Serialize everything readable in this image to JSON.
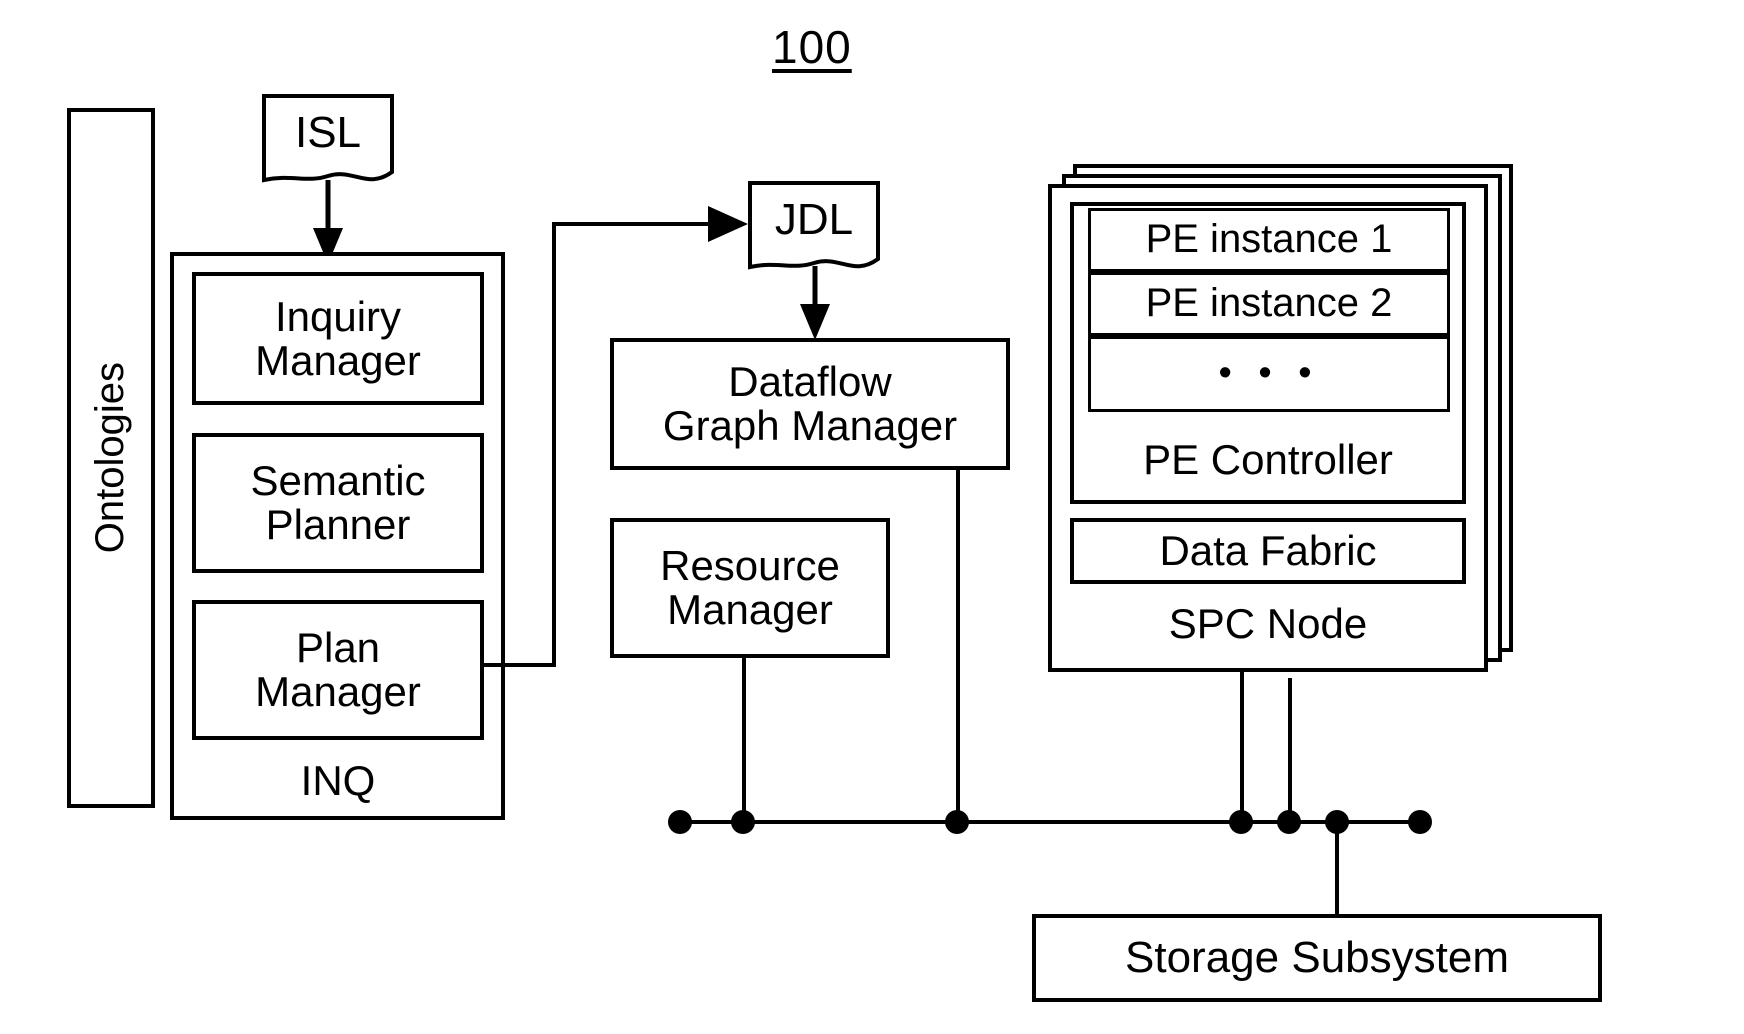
{
  "figure": {
    "number": "100"
  },
  "ontologies": {
    "label": "Ontologies"
  },
  "isl": {
    "label": "ISL"
  },
  "inq": {
    "label": "INQ",
    "components": [
      {
        "label": "Inquiry\nManager",
        "line1": "Inquiry",
        "line2": "Manager"
      },
      {
        "label": "Semantic\nPlanner",
        "line1": "Semantic",
        "line2": "Planner"
      },
      {
        "label": "Plan\nManager",
        "line1": "Plan",
        "line2": "Manager"
      }
    ]
  },
  "jdl": {
    "label": "JDL"
  },
  "dataflow_graph_manager": {
    "line1": "Dataflow",
    "line2": "Graph Manager"
  },
  "resource_manager": {
    "line1": "Resource",
    "line2": "Manager"
  },
  "spc_node": {
    "label": "SPC Node",
    "pe_controller": {
      "label": "PE Controller",
      "instances": [
        {
          "label": "PE instance 1"
        },
        {
          "label": "PE instance 2"
        },
        {
          "label": "• • •"
        }
      ]
    },
    "data_fabric": {
      "label": "Data Fabric"
    }
  },
  "storage_subsystem": {
    "label": "Storage Subsystem"
  },
  "colors": {
    "stroke": "#000000",
    "background": "#ffffff"
  }
}
